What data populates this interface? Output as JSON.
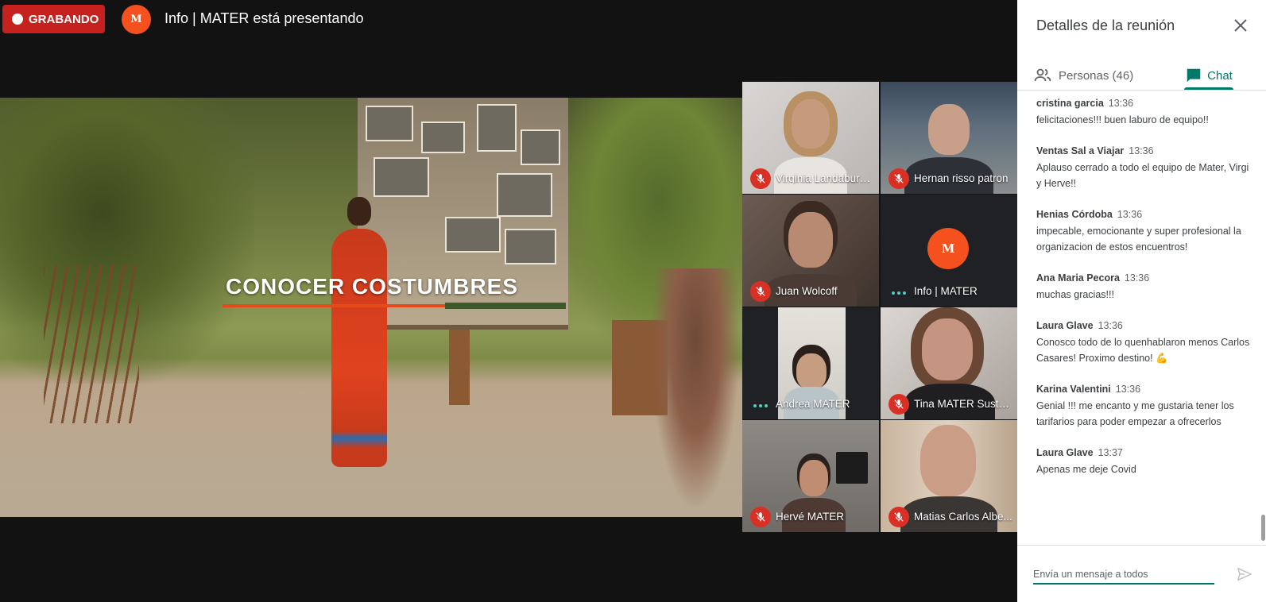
{
  "header": {
    "recording_label": "GRABANDO",
    "presenter_logo": "M",
    "presenter_text": "Info | MATER está presentando"
  },
  "presentation": {
    "caption": "CONOCER COSTUMBRES"
  },
  "participants": [
    {
      "name": "Virginia Landaburu-Che...",
      "mic": "muted"
    },
    {
      "name": "Hernan risso patron",
      "mic": "muted"
    },
    {
      "name": "Juan Wolcoff",
      "mic": "muted"
    },
    {
      "name": "Info | MATER",
      "mic": "speaking",
      "avatar": "M"
    },
    {
      "name": "Andrea MATER",
      "mic": "speaking"
    },
    {
      "name": "Tina MATER Suste...",
      "mic": "muted"
    },
    {
      "name": "Hervé MATER",
      "mic": "muted"
    },
    {
      "name": "Matias Carlos Albe...",
      "mic": "muted"
    }
  ],
  "panel": {
    "title": "Detalles de la reunión",
    "tab_people": "Personas (46)",
    "tab_chat": "Chat",
    "active_tab": "Chat",
    "accent_color": "#00796b",
    "input_placeholder": "Envía un mensaje a todos"
  },
  "chat": [
    {
      "sender": "cristina garcia",
      "time": "13:36",
      "text": "felicitaciones!!! buen laburo de equipo!!"
    },
    {
      "sender": "Ventas Sal a Viajar",
      "time": "13:36",
      "text": "Aplauso cerrado a todo el equipo de Mater, Virgi y Herve!!"
    },
    {
      "sender": "Henias Córdoba",
      "time": "13:36",
      "text": "impecable, emocionante y super profesional la organizacion de estos encuentros!"
    },
    {
      "sender": "Ana Maria Pecora",
      "time": "13:36",
      "text": "muchas gracias!!!"
    },
    {
      "sender": "Laura Glave",
      "time": "13:36",
      "text": "Conosco todo de lo quenhablaron menos Carlos Casares! Proximo destino! 💪"
    },
    {
      "sender": "Karina Valentini",
      "time": "13:36",
      "text": "Genial !!! me encanto  y me gustaria tener los tarifarios para poder empezar a ofrecerlos"
    },
    {
      "sender": "Laura Glave",
      "time": "13:37",
      "text": "Apenas me deje Covid"
    }
  ]
}
